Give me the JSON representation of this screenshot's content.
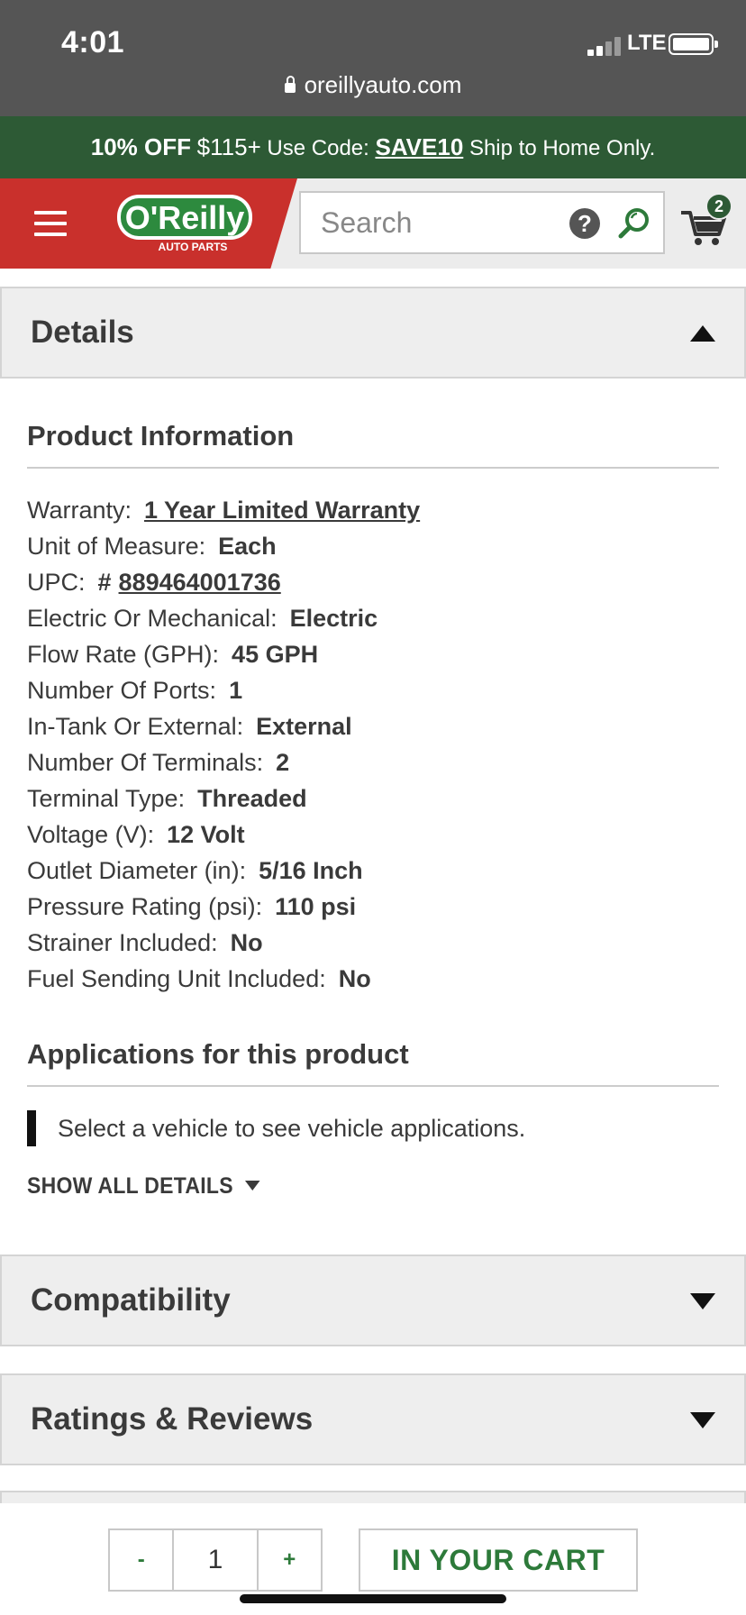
{
  "status_bar": {
    "time": "4:01",
    "carrier": "LTE",
    "url": "oreillyauto.com"
  },
  "promo": {
    "discount": "10% OFF",
    "amount": "$115+",
    "use_code_label": "Use Code:",
    "code": "SAVE10",
    "note": "Ship to Home Only."
  },
  "header": {
    "logo_text": "O'Reilly",
    "logo_subtext": "AUTO PARTS",
    "search_placeholder": "Search",
    "help_icon_text": "?",
    "cart_count": "2"
  },
  "details": {
    "title": "Details",
    "product_info_heading": "Product Information",
    "specs": [
      {
        "label": "Warranty:",
        "value": "1 Year Limited Warranty"
      },
      {
        "label": "Unit of Measure:",
        "value": "Each"
      },
      {
        "label": "UPC:",
        "prefix": "#",
        "value": "889464001736"
      },
      {
        "label": "Electric Or Mechanical:",
        "value": "Electric"
      },
      {
        "label": "Flow Rate (GPH):",
        "value": "45 GPH"
      },
      {
        "label": "Number Of Ports:",
        "value": "1"
      },
      {
        "label": "In-Tank Or External:",
        "value": "External"
      },
      {
        "label": "Number Of Terminals:",
        "value": "2"
      },
      {
        "label": "Terminal Type:",
        "value": "Threaded"
      },
      {
        "label": "Voltage (V):",
        "value": "12 Volt"
      },
      {
        "label": "Outlet Diameter (in):",
        "value": "5/16 Inch"
      },
      {
        "label": "Pressure Rating (psi):",
        "value": "110 psi"
      },
      {
        "label": "Strainer Included:",
        "value": "No"
      },
      {
        "label": "Fuel Sending Unit Included:",
        "value": "No"
      }
    ],
    "applications_heading": "Applications for this product",
    "applications_message": "Select a vehicle to see vehicle applications.",
    "show_all_label": "SHOW ALL DETAILS"
  },
  "compatibility": {
    "title": "Compatibility"
  },
  "ratings": {
    "title": "Ratings & Reviews"
  },
  "bottom_bar": {
    "minus_label": "-",
    "quantity": "1",
    "plus_label": "+",
    "cart_button_label": "IN YOUR CART"
  },
  "colors": {
    "brand_green": "#2d5a35",
    "brand_red": "#c9302c",
    "accent_green": "#2d7a3a"
  }
}
